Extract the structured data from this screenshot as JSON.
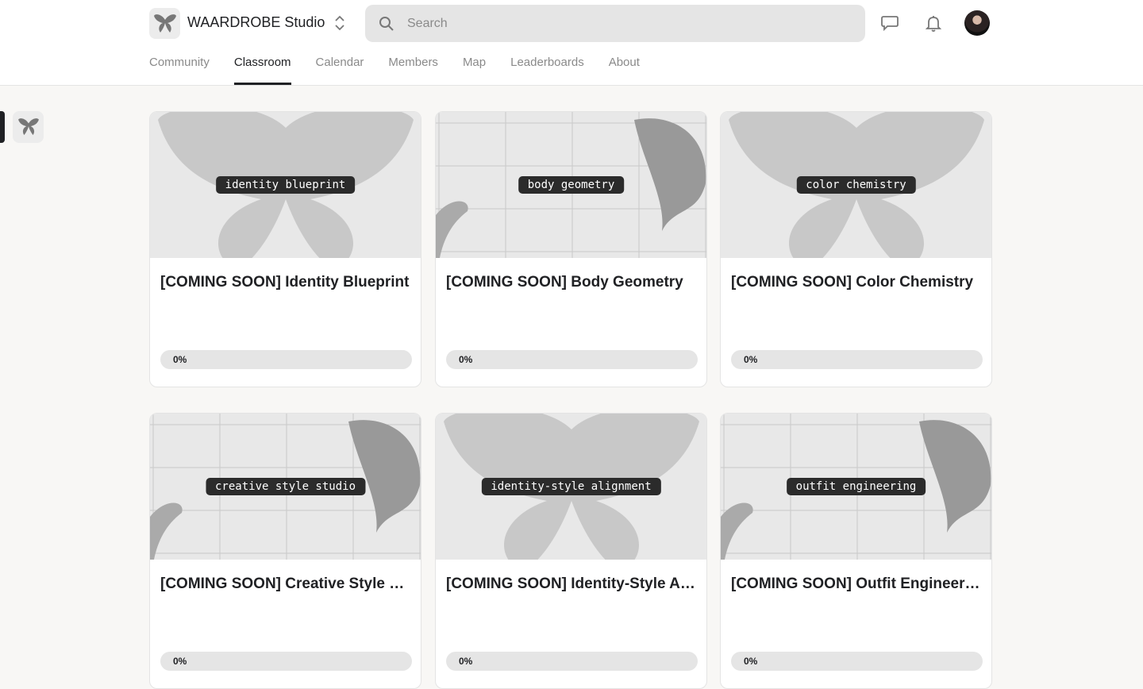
{
  "header": {
    "brand": "WAARDROBE Studio",
    "search_placeholder": "Search"
  },
  "nav": [
    {
      "label": "Community"
    },
    {
      "label": "Classroom",
      "active": true
    },
    {
      "label": "Calendar"
    },
    {
      "label": "Members"
    },
    {
      "label": "Map"
    },
    {
      "label": "Leaderboards"
    },
    {
      "label": "About"
    }
  ],
  "courses": [
    {
      "tag": "identity blueprint",
      "title": "[COMING SOON] Identity Blueprint",
      "progress": "0%",
      "progress_value": 0,
      "art": "butterfly"
    },
    {
      "tag": "body geometry",
      "title": "[COMING SOON] Body Geometry",
      "progress": "0%",
      "progress_value": 0,
      "art": "grid"
    },
    {
      "tag": "color chemistry",
      "title": "[COMING SOON] Color Chemistry",
      "progress": "0%",
      "progress_value": 0,
      "art": "butterfly"
    },
    {
      "tag": "creative style studio",
      "title": "[COMING SOON] Creative Style Studio",
      "progress": "0%",
      "progress_value": 0,
      "art": "grid"
    },
    {
      "tag": "identity-style alignment",
      "title": "[COMING SOON] Identity-Style Alignment",
      "progress": "0%",
      "progress_value": 0,
      "art": "butterfly"
    },
    {
      "tag": "outfit engineering",
      "title": "[COMING SOON] Outfit Engineering",
      "progress": "0%",
      "progress_value": 0,
      "art": "grid"
    }
  ]
}
